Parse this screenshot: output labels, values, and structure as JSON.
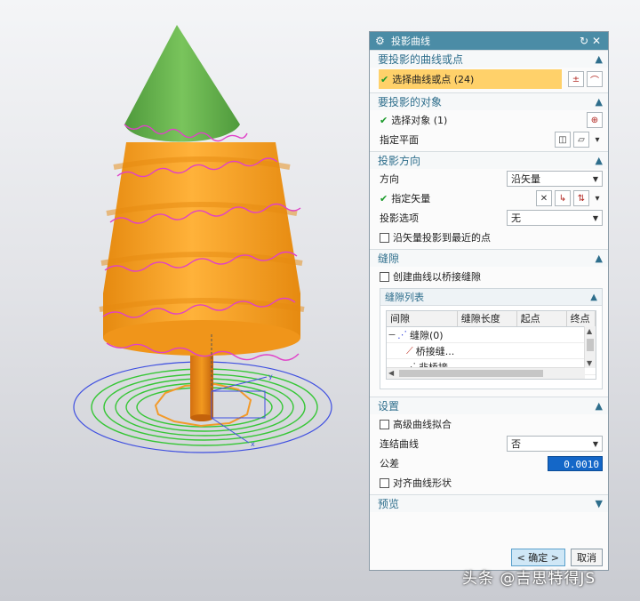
{
  "dialog": {
    "title": "投影曲线",
    "sections": {
      "curves": {
        "title": "要投影的曲线或点",
        "select_label": "选择曲线或点 (24)"
      },
      "objects": {
        "title": "要投影的对象",
        "select_label": "选择对象 (1)",
        "plane_label": "指定平面"
      },
      "direction": {
        "title": "投影方向",
        "direction_label": "方向",
        "direction_value": "沿矢量",
        "vector_label": "指定矢量",
        "option_label": "投影选项",
        "option_value": "无",
        "nearest_label": "沿矢量投影到最近的点"
      },
      "gap": {
        "title": "缝隙",
        "bridge_label": "创建曲线以桥接缝隙",
        "list_title": "缝隙列表",
        "columns": [
          "间隙",
          "缝隙长度",
          "起点",
          "终点"
        ],
        "rows": [
          "缝隙(0)",
          "桥接缝...",
          "非桥接..."
        ]
      },
      "settings": {
        "title": "设置",
        "fit_label": "高级曲线拟合",
        "join_label": "连结曲线",
        "join_value": "否",
        "tolerance_label": "公差",
        "tolerance_value": "0.0010",
        "align_label": "对齐曲线形状"
      },
      "preview": {
        "title": "预览"
      }
    },
    "buttons": {
      "ok": "< 确定 >",
      "cancel": "取消"
    }
  },
  "watermark": "头条 @吉思特得JS",
  "colors": {
    "title_bar": "#4b8ca6",
    "section_text": "#2e6e8c",
    "highlight": "#ffd16a",
    "cone_green": "#6ab34f",
    "tree_orange": "#f7a21b",
    "curve_magenta": "#e040c8",
    "base_curve_green": "#36c636",
    "base_curve_blue": "#3f4fe0"
  }
}
